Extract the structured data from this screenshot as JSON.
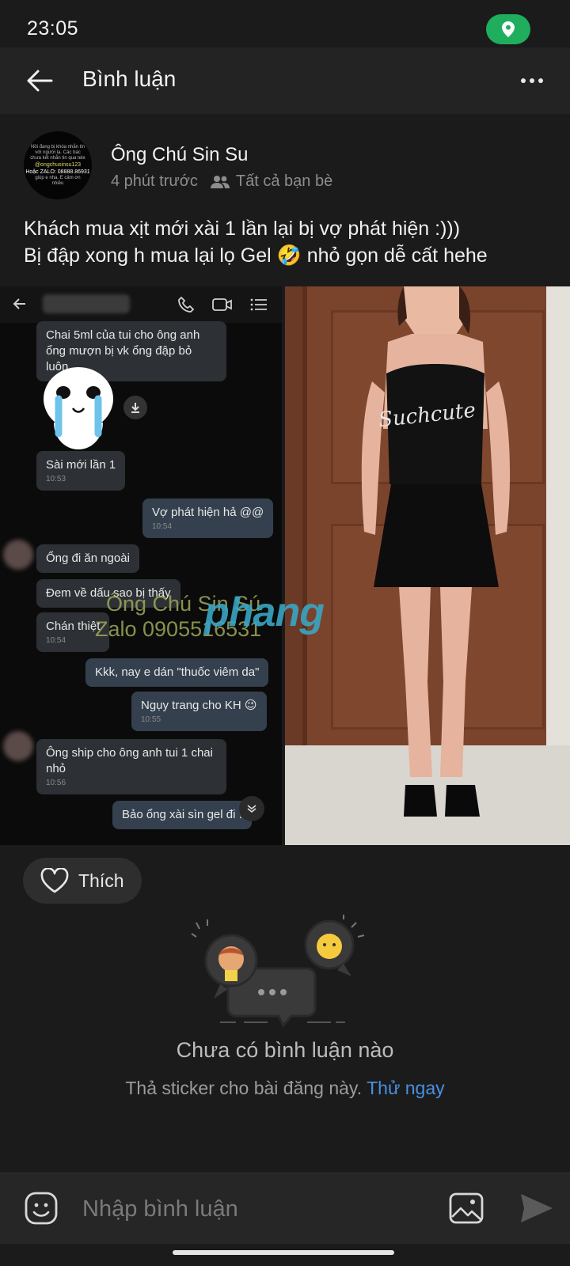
{
  "status_bar": {
    "time": "23:05"
  },
  "header": {
    "title": "Bình luận"
  },
  "post": {
    "author": "Ông Chú Sin Su",
    "time_ago": "4 phút trước",
    "audience": "Tất cả bạn bè",
    "text_line1": "Khách mua xịt mới xài 1 lần lại bị vợ phát hiện :)))",
    "text_line2": "Bị đập xong h mua lại lọ Gel 🤣 nhỏ gọn dễ cất hehe",
    "avatar_text": {
      "line1": "Nồi đang bị khóa nhắn tin với người lạ. Các bác chưa kết nhắn tin qua tele",
      "line2": "@ongchusinsu123",
      "line3": "Hoặc ZALO: 08888.86931",
      "line4": "giúp e nha. E cảm ơn nhiều"
    }
  },
  "chat_screenshot": {
    "messages": [
      {
        "text": "Chai 5ml của tui cho ông anh ổng mượn bị vk ổng đập bỏ luôn",
        "time": "",
        "side": "them"
      },
      {
        "text": "Sài mới lần 1",
        "time": "10:53",
        "side": "them"
      },
      {
        "text": "Vợ phát hiện hả @@",
        "time": "10:54",
        "side": "me"
      },
      {
        "text": "Ổng đi ăn ngoài",
        "time": "",
        "side": "them"
      },
      {
        "text": "Đem về dấu sao bị thấy",
        "time": "",
        "side": "them"
      },
      {
        "text": "Chán thiệt",
        "time": "10:54",
        "side": "them"
      },
      {
        "text": "Kkk, nay e dán \"thuốc viêm da\"",
        "time": "",
        "side": "me"
      },
      {
        "text": "Ngụy trang cho KH 😉",
        "time": "10:55",
        "side": "me"
      },
      {
        "text": "Ông ship cho ông anh tui 1 chai nhỏ",
        "time": "10:56",
        "side": "them"
      },
      {
        "text": "Bảo ổng xài sìn gel đi .",
        "time": "",
        "side": "me"
      }
    ],
    "watermark_name": "Ông Chú Sin Sú",
    "watermark_zalo": "Zalo 0905516531",
    "watermark_brand": "phang"
  },
  "photo": {
    "shirt_text": "Suchcute"
  },
  "actions": {
    "like_label": "Thích"
  },
  "empty_state": {
    "title": "Chưa có bình luận nào",
    "subtitle": "Thả sticker cho bài đăng này.",
    "cta": "Thử ngay"
  },
  "comment_bar": {
    "placeholder": "Nhập bình luận"
  },
  "colors": {
    "accent_link": "#4a90e2",
    "location_pill": "#1fae5e",
    "background": "#1b1b1b"
  }
}
